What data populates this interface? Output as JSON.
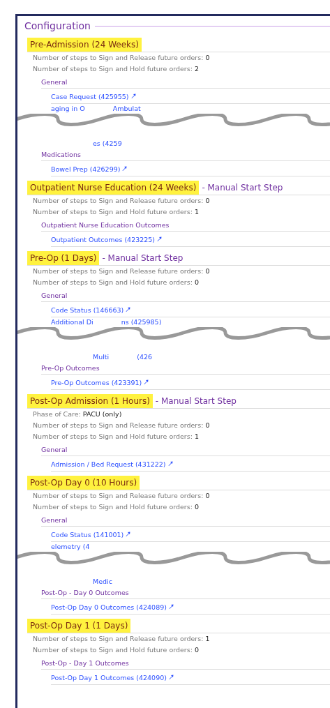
{
  "section": {
    "title": "Configuration"
  },
  "steps": [
    {
      "name": "Pre-Admission (24 Weeks)",
      "rows": [
        {
          "kind": "detail",
          "label": "Number of steps to Sign and Release future orders:",
          "value": "0"
        },
        {
          "kind": "detail",
          "label": "Number of steps to Sign and Hold future orders:",
          "value": "2"
        },
        {
          "kind": "category",
          "text": "General"
        },
        {
          "kind": "order",
          "text": "Case Request (425955)"
        },
        {
          "kind": "tear",
          "upper": [
            "aging in O",
            "Ambulat"
          ],
          "lower": [
            "es (4259"
          ]
        },
        {
          "kind": "category",
          "text": "Medications"
        },
        {
          "kind": "order",
          "text": "Bowel Prep (426299)"
        }
      ]
    },
    {
      "name": "Outpatient Nurse Education (24 Weeks)",
      "manual_label": "- Manual Start Step",
      "rows": [
        {
          "kind": "detail",
          "label": "Number of steps to Sign and Release future orders:",
          "value": "0"
        },
        {
          "kind": "detail",
          "label": "Number of steps to Sign and Hold future orders:",
          "value": "1"
        },
        {
          "kind": "category",
          "text": "Outpatient Nurse Education Outcomes"
        },
        {
          "kind": "order",
          "text": "Outpatient Outcomes (423225)"
        }
      ]
    },
    {
      "name": "Pre-Op (1 Days)",
      "manual_label": "- Manual Start Step",
      "rows": [
        {
          "kind": "detail",
          "label": "Number of steps to Sign and Release future orders:",
          "value": "0"
        },
        {
          "kind": "detail",
          "label": "Number of steps to Sign and Hold future orders:",
          "value": "0"
        },
        {
          "kind": "category",
          "text": "General"
        },
        {
          "kind": "order",
          "text": "Code Status (146663)"
        },
        {
          "kind": "tear",
          "upper": [
            "Additional Di",
            "ns (425985)"
          ],
          "lower": [
            "Multi",
            "(426"
          ]
        },
        {
          "kind": "category",
          "text": "Pre-Op Outcomes"
        },
        {
          "kind": "order",
          "text": "Pre-Op Outcomes (423391)"
        }
      ]
    },
    {
      "name": "Post-Op Admission (1 Hours)",
      "manual_label": "- Manual Start Step",
      "rows": [
        {
          "kind": "detail",
          "label": "Phase of Care:",
          "value": "PACU (only)"
        },
        {
          "kind": "detail",
          "label": "Number of steps to Sign and Release future orders:",
          "value": "0"
        },
        {
          "kind": "detail",
          "label": "Number of steps to Sign and Hold future orders:",
          "value": "1"
        },
        {
          "kind": "category",
          "text": "General"
        },
        {
          "kind": "order",
          "text": "Admission / Bed Request (431222)"
        }
      ]
    },
    {
      "name": "Post-Op Day 0 (10 Hours)",
      "rows": [
        {
          "kind": "detail",
          "label": "Number of steps to Sign and Release future orders:",
          "value": "0"
        },
        {
          "kind": "detail",
          "label": "Number of steps to Sign and Hold future orders:",
          "value": "0"
        },
        {
          "kind": "category",
          "text": "General"
        },
        {
          "kind": "order",
          "text": "Code Status (141001)"
        },
        {
          "kind": "tear",
          "upper": [
            "elemetry (4"
          ],
          "lower": [
            "Medic"
          ]
        },
        {
          "kind": "category",
          "text": "Post-Op - Day 0 Outcomes"
        },
        {
          "kind": "order",
          "text": "Post-Op Day 0 Outcomes (424089)"
        }
      ]
    },
    {
      "name": "Post-Op Day 1 (1 Days)",
      "rows": [
        {
          "kind": "detail",
          "label": "Number of steps to Sign and Release future orders:",
          "value": "1"
        },
        {
          "kind": "detail",
          "label": "Number of steps to Sign and Hold future orders:",
          "value": "0"
        },
        {
          "kind": "category",
          "text": "Post-Op - Day 1 Outcomes"
        },
        {
          "kind": "order",
          "text": "Post-Op Day 1 Outcomes (424090)"
        }
      ]
    }
  ]
}
